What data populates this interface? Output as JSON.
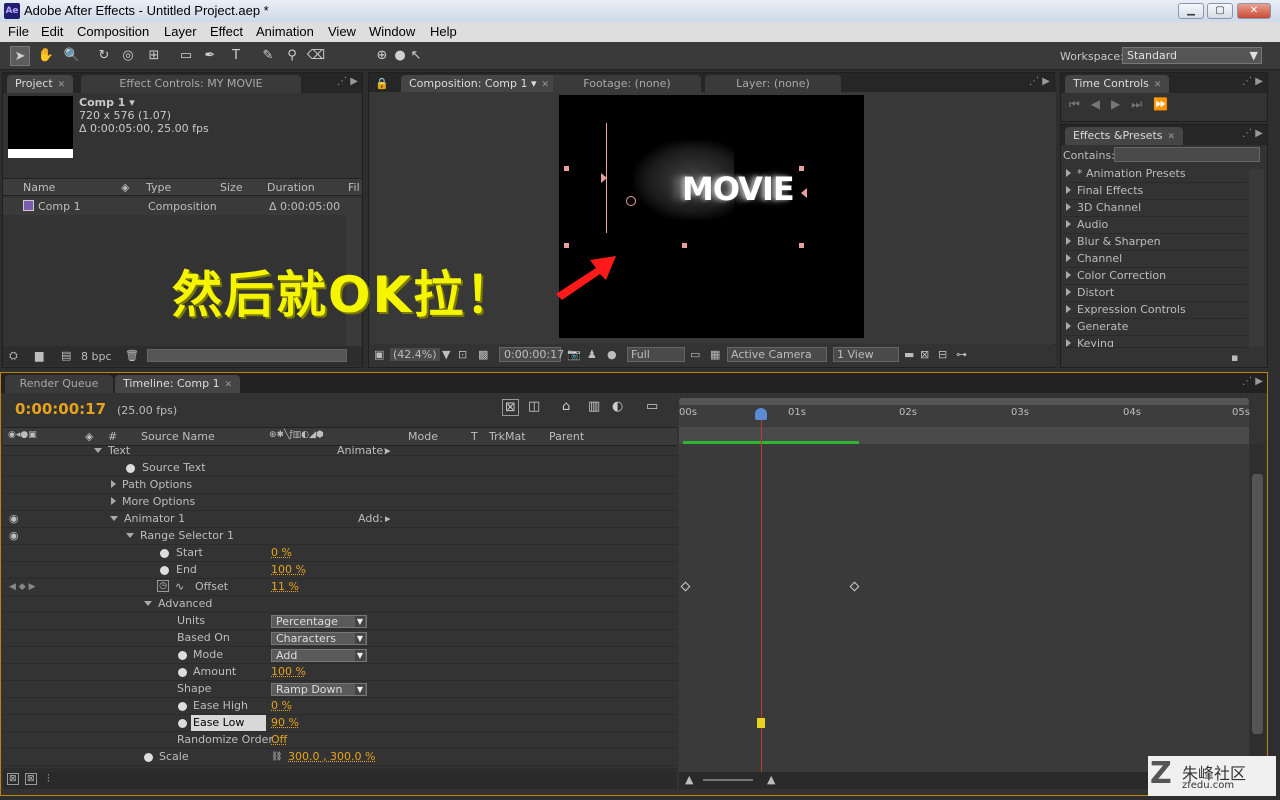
{
  "window": {
    "title": "Adobe After Effects - Untitled Project.aep *",
    "app_icon": "Ae",
    "min": "▁",
    "max": "▢",
    "close": "✕"
  },
  "menu": [
    "File",
    "Edit",
    "Composition",
    "Layer",
    "Effect",
    "Animation",
    "View",
    "Window",
    "Help"
  ],
  "workspace": {
    "label": "Workspace:",
    "value": "Standard"
  },
  "project_panel": {
    "tabs": [
      "Project",
      "Effect Controls: MY MOVIE"
    ],
    "comp_name": "Comp 1",
    "dimensions": "720 x 576 (1.07)",
    "duration_info": "Δ 0:00:05:00, 25.00 fps",
    "columns": [
      "Name",
      "Type",
      "Size",
      "Duration",
      "Fil"
    ],
    "row": {
      "name": "Comp 1",
      "type": "Composition",
      "duration": "Δ 0:00:05:00"
    },
    "bpc": "8 bpc"
  },
  "viewer": {
    "tabs": [
      "Composition: Comp 1",
      "Footage: (none)",
      "Layer: (none)"
    ],
    "canvas_text": "MOVIE",
    "zoom": "(42.4%)",
    "timecode": "0:00:00:17",
    "resolution": "Full",
    "camera": "Active Camera",
    "views": "1 View"
  },
  "overlay_text": "然后就OK拉！",
  "time_controls": {
    "tab": "Time Controls"
  },
  "effects_presets": {
    "tab": "Effects &Presets",
    "contains_label": "Contains:",
    "items": [
      "* Animation Presets",
      "Final Effects",
      "3D Channel",
      "Audio",
      "Blur & Sharpen",
      "Channel",
      "Color Correction",
      "Distort",
      "Expression Controls",
      "Generate",
      "Keying"
    ]
  },
  "timeline": {
    "tabs": [
      "Render Queue",
      "Timeline: Comp 1"
    ],
    "current_time": "0:00:00:17",
    "fps": "(25.00 fps)",
    "columns": {
      "num": "#",
      "source": "Source Name",
      "mode": "Mode",
      "t": "T",
      "trkmat": "TrkMat",
      "parent": "Parent"
    },
    "ruler": [
      "00s",
      "01s",
      "02s",
      "03s",
      "04s",
      "05s"
    ],
    "rows": [
      {
        "label": "Text",
        "extra": "Animate:"
      },
      {
        "label": "Source Text"
      },
      {
        "label": "Path Options"
      },
      {
        "label": "More Options"
      },
      {
        "label": "Animator 1",
        "extra": "Add:"
      },
      {
        "label": "Range Selector 1"
      },
      {
        "label": "Start",
        "value": "0 %"
      },
      {
        "label": "End",
        "value": "100 %"
      },
      {
        "label": "Offset",
        "value": "11 %"
      },
      {
        "label": "Advanced"
      },
      {
        "label": "Units",
        "select": "Percentage"
      },
      {
        "label": "Based On",
        "select": "Characters"
      },
      {
        "label": "Mode",
        "select": "Add"
      },
      {
        "label": "Amount",
        "value": "100 %"
      },
      {
        "label": "Shape",
        "select": "Ramp Down"
      },
      {
        "label": "Ease High",
        "value": "0 %"
      },
      {
        "label": "Ease Low",
        "value": "90 %"
      },
      {
        "label": "Randomize Order",
        "value": "Off"
      },
      {
        "label": "Scale",
        "value": "300.0 , 300.0 %"
      }
    ]
  },
  "watermark": {
    "text": "朱峰社区",
    "url": "zfedu.com"
  }
}
